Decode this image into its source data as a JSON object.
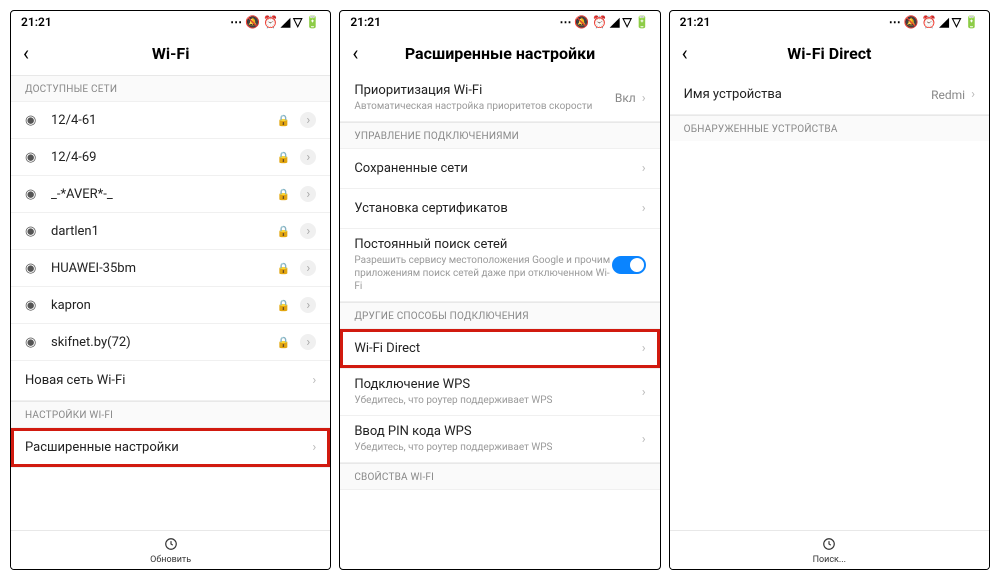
{
  "status": {
    "time": "21:21",
    "icons": "⋯ 🔕 ⏰ ◢ ▽ 🔋"
  },
  "screen1": {
    "title": "Wi-Fi",
    "sec_available": "ДОСТУПНЫЕ СЕТИ",
    "networks": [
      "12/4-61",
      "12/4-69",
      "_-*AVER*-_",
      "dartlen1",
      "HUAWEI-35bm",
      "kapron",
      "skifnet.by(72)"
    ],
    "new_network": "Новая сеть Wi-Fi",
    "sec_settings": "НАСТРОЙКИ WI-FI",
    "advanced": "Расширенные настройки",
    "refresh": "Обновить"
  },
  "screen2": {
    "title": "Расширенные настройки",
    "priority_title": "Приоритизация Wi-Fi",
    "priority_sub": "Автоматическая настройка приоритетов скорости",
    "priority_value": "Вкл",
    "sec_conn": "УПРАВЛЕНИЕ ПОДКЛЮЧЕНИЯМИ",
    "saved": "Сохраненные сети",
    "certs": "Установка сертификатов",
    "scan_title": "Постоянный поиск сетей",
    "scan_sub": "Разрешить сервису местоположения Google и прочим приложениям поиск сетей даже при отключенном Wi-Fi",
    "sec_other": "ДРУГИЕ СПОСОБЫ ПОДКЛЮЧЕНИЯ",
    "wifi_direct": "Wi-Fi Direct",
    "wps_title": "Подключение WPS",
    "wps_sub": "Убедитесь, что роутер поддерживает WPS",
    "wps_pin_title": "Ввод PIN кода WPS",
    "wps_pin_sub": "Убедитесь, что роутер поддерживает WPS",
    "sec_props": "СВОЙСТВА WI-FI"
  },
  "screen3": {
    "title": "Wi-Fi Direct",
    "device_name_label": "Имя устройства",
    "device_name_value": "Redmi",
    "sec_discovered": "ОБНАРУЖЕННЫЕ УСТРОЙСТВА",
    "search": "Поиск..."
  }
}
